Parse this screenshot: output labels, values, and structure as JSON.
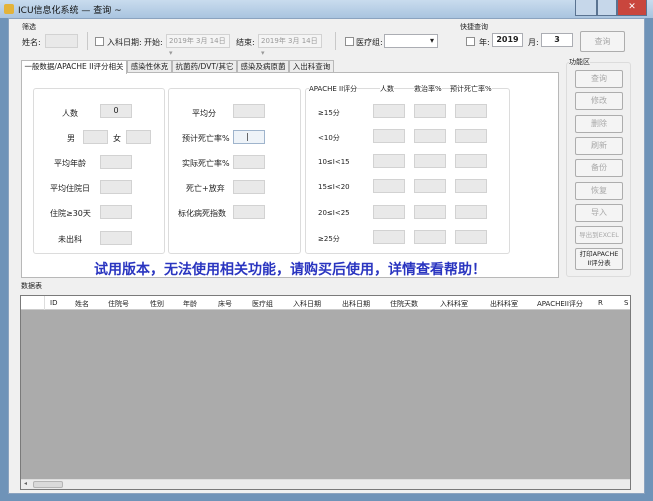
{
  "window": {
    "title": "ICU信息化系统 — 查询 ~"
  },
  "filter": {
    "group_label": "筛选",
    "name_label": "姓名:",
    "name_value": "",
    "admit_date_label": "入科日期:",
    "start_label": "开始:",
    "start_date": "2019年 3月 14日",
    "end_label": "结束:",
    "end_date": "2019年 3月 14日",
    "medical_group_label": "医疗组:",
    "medical_group_value": ""
  },
  "quick_query": {
    "group_label": "快捷查询",
    "year_label": "年:",
    "year_value": "2019",
    "month_label": "月:",
    "month_value": "3",
    "query_button": "查询"
  },
  "tabs": [
    {
      "label": "一般数据/APACHE II评分相关"
    },
    {
      "label": "感染性休克"
    },
    {
      "label": "抗菌药/DVT/其它"
    },
    {
      "label": "感染及病原菌"
    },
    {
      "label": "入出科查询"
    }
  ],
  "general": {
    "count_label": "人数",
    "count_value": "0",
    "male_label": "男",
    "female_label": "女",
    "avg_age_label": "平均年龄",
    "avg_stay_label": "平均住院日",
    "stay30_label": "住院≥30天",
    "not_discharged_label": "未出科"
  },
  "scores": {
    "avg_score_label": "平均分",
    "pred_mortality_label": "预计死亡率%",
    "actual_mortality_label": "实际死亡率%",
    "death_abandon_label": "死亡+放弃",
    "std_mortality_label": "标化病死指数"
  },
  "apache_table": {
    "headers": [
      "APACHE II评分",
      "人数",
      "救治率%",
      "预计死亡率%"
    ],
    "rows": [
      {
        "label": "≥15分"
      },
      {
        "label": "<10分"
      },
      {
        "label": "10≤I<15"
      },
      {
        "label": "15≤I<20"
      },
      {
        "label": "20≤I<25"
      },
      {
        "label": "≥25分"
      }
    ]
  },
  "trial_notice": "试用版本，无法使用相关功能，请购买后使用，详情查看帮助！",
  "function_area": {
    "label": "功能区",
    "buttons": [
      "查询",
      "修改",
      "删除",
      "刷新",
      "备份",
      "恢复",
      "导入",
      "导出到EXCEL",
      "打印APACHE II评分表"
    ]
  },
  "data_table": {
    "label": "数据表",
    "columns": [
      "ID",
      "姓名",
      "住院号",
      "性别",
      "年龄",
      "床号",
      "医疗组",
      "入科日期",
      "出科日期",
      "住院天数",
      "入科科室",
      "出科科室",
      "APACHEII评分",
      "R",
      "S"
    ]
  }
}
